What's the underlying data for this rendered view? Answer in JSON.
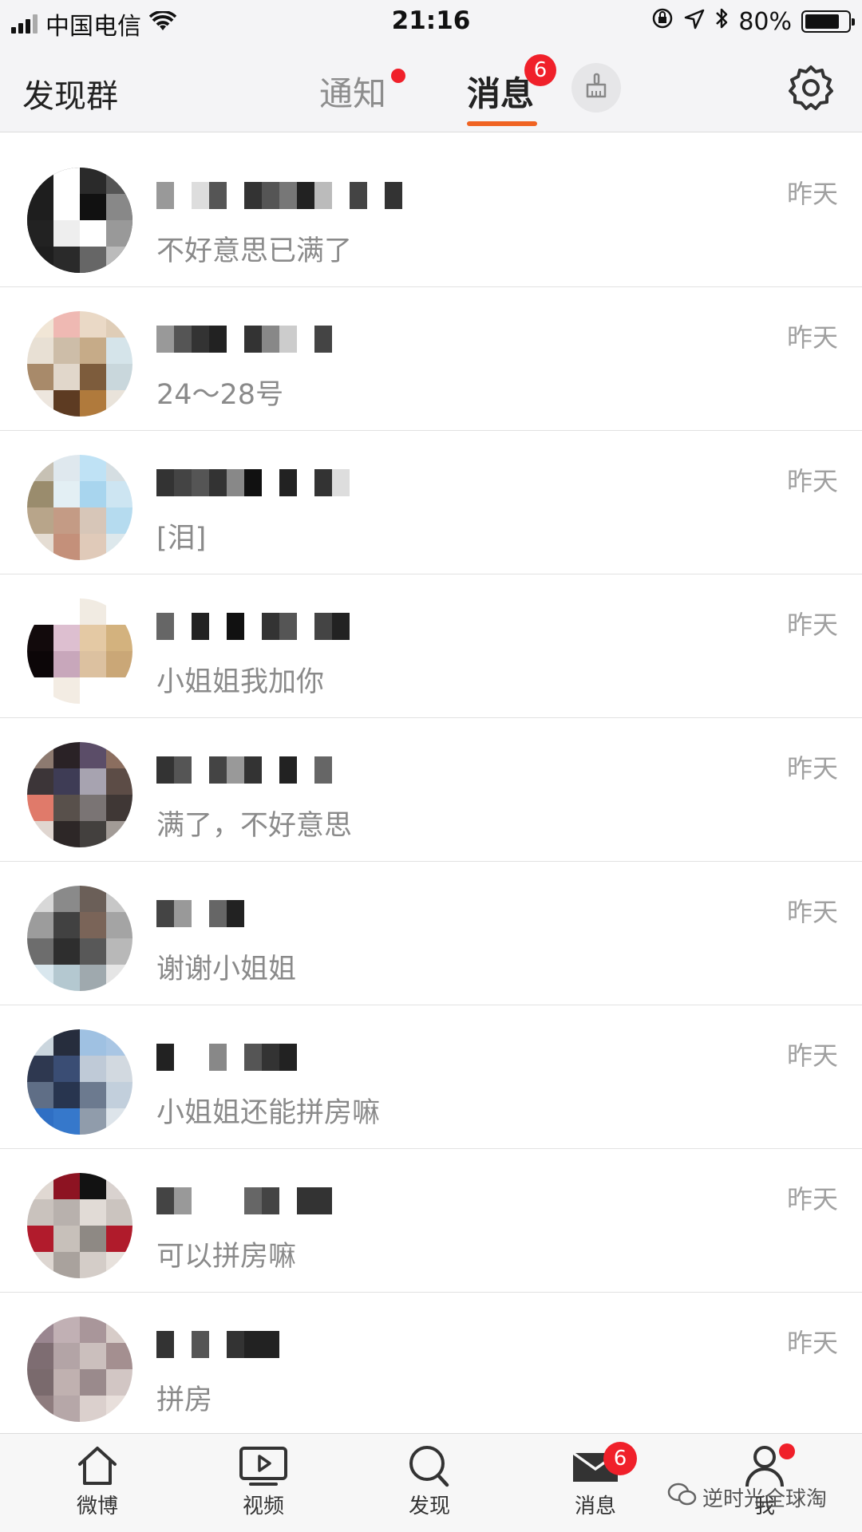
{
  "status_bar": {
    "carrier": "中国电信",
    "time": "21:16",
    "battery_percent": "80%",
    "battery_level": 0.8
  },
  "header": {
    "discover_group": "发现群",
    "tabs": [
      {
        "label": "通知",
        "has_dot": true
      },
      {
        "label": "消息",
        "badge": "6",
        "active": true
      }
    ],
    "clean_icon": "broom-icon",
    "settings_icon": "gear-icon"
  },
  "messages": [
    {
      "preview": "不好意思已满了",
      "time": "昨天"
    },
    {
      "preview": "24～28号",
      "time": "昨天"
    },
    {
      "preview": "[泪]",
      "time": "昨天"
    },
    {
      "preview": "小姐姐我加你",
      "time": "昨天"
    },
    {
      "preview": "满了，不好意思",
      "time": "昨天"
    },
    {
      "preview": "谢谢小姐姐",
      "time": "昨天"
    },
    {
      "preview": "小姐姐还能拼房嘛",
      "time": "昨天"
    },
    {
      "preview": "可以拼房嘛",
      "time": "昨天"
    },
    {
      "preview": "拼房",
      "time": "昨天"
    }
  ],
  "tabbar": {
    "items": [
      {
        "label": "微博",
        "icon": "home-icon"
      },
      {
        "label": "视频",
        "icon": "video-icon"
      },
      {
        "label": "发现",
        "icon": "search-icon"
      },
      {
        "label": "消息",
        "icon": "mail-icon",
        "badge": "6"
      },
      {
        "label": "我",
        "icon": "profile-icon",
        "has_dot": true
      }
    ]
  },
  "watermark": "逆时光全球淘"
}
